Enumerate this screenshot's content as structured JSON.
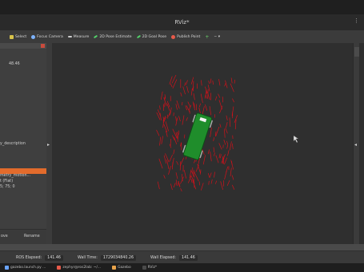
{
  "window": {
    "title": "RViz*",
    "menu_dots": "⋮"
  },
  "toolbar": {
    "items": [
      {
        "label": "Select",
        "icon": "cursor-icon",
        "color": "#d7c24a"
      },
      {
        "label": "Focus Camera",
        "icon": "focus-icon",
        "color": "#7db3ff"
      },
      {
        "label": "Measure",
        "icon": "measure-icon",
        "color": "#cfcfcf"
      },
      {
        "label": "2D Pose Estimate",
        "icon": "pose-estimate-icon",
        "color": "#53d36a"
      },
      {
        "label": "2D Goal Pose",
        "icon": "goal-pose-icon",
        "color": "#53d36a"
      },
      {
        "label": "Publish Point",
        "icon": "publish-point-icon",
        "color": "#e85a4a"
      }
    ],
    "add_label": "+",
    "more_label": "−  ▾"
  },
  "left_panel": {
    "value_1": "48.46",
    "description": "y_description",
    "selected_item": "",
    "line_1": "metry_motion...",
    "line_2": "t (Flat)",
    "line_3": "5; 75; 0",
    "bottom_left": "ove",
    "bottom_right": "Rename"
  },
  "status": {
    "ros_elapsed_label": "ROS Elapsed:",
    "ros_elapsed_value": "141.46",
    "wall_time_label": "Wall Time:",
    "wall_time_value": "1729034840.26",
    "wall_elapsed_label": "Wall Elapsed:",
    "wall_elapsed_value": "141.46"
  },
  "taskbar": {
    "items": [
      {
        "label": "gazebo.launch.py ...",
        "color": "#6aa4ff"
      },
      {
        "label": "zephyr@ros2lab: ~/...",
        "color": "#e85a4a"
      },
      {
        "label": "Gazebo",
        "color": "#e8a24a"
      },
      {
        "label": "RViz*",
        "color": "#4a4a4a"
      }
    ]
  },
  "colors": {
    "robot_body": "#1f8d2b",
    "robot_outline": "#0d4d17",
    "particles": "#d0121b",
    "orange_select": "#e26b2c"
  }
}
